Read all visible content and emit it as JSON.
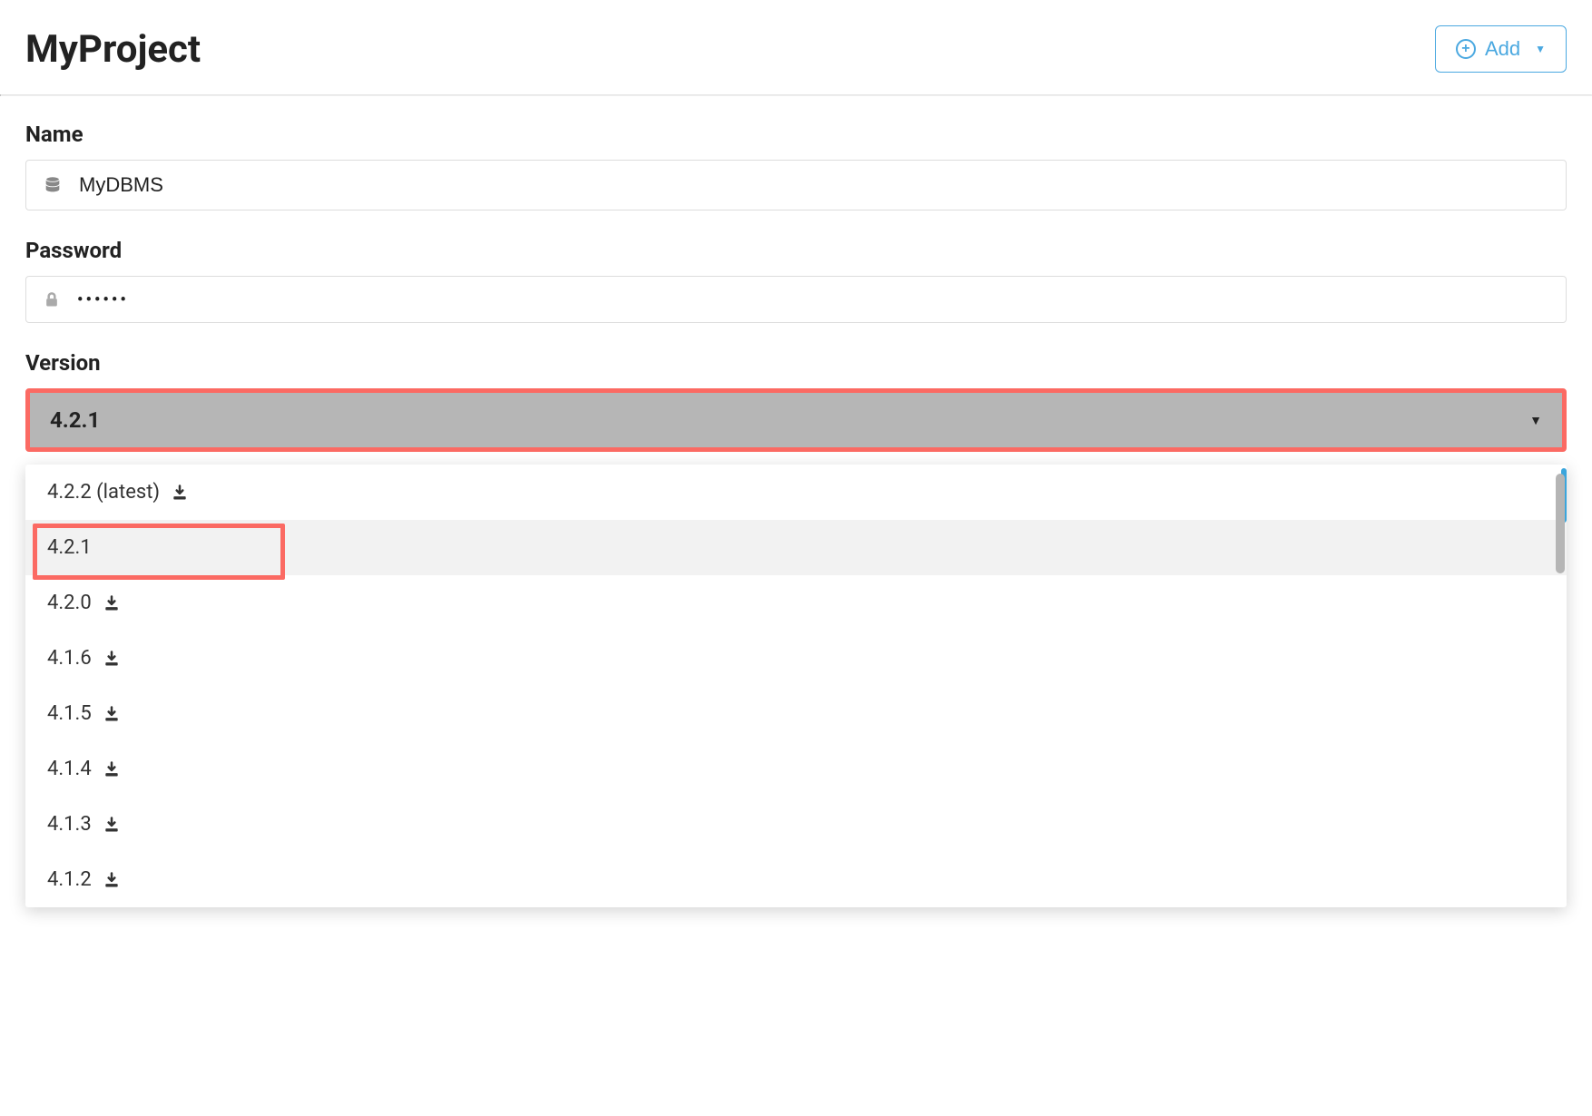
{
  "header": {
    "project_title": "MyProject",
    "add_label": "Add"
  },
  "form": {
    "name": {
      "label": "Name",
      "value": "MyDBMS"
    },
    "password": {
      "label": "Password",
      "value": "••••••"
    },
    "version": {
      "label": "Version",
      "selected": "4.2.1",
      "options": [
        {
          "label": "4.2.2 (latest)",
          "downloadable": true,
          "selected": false
        },
        {
          "label": "4.2.1",
          "downloadable": false,
          "selected": true
        },
        {
          "label": "4.2.0",
          "downloadable": true,
          "selected": false
        },
        {
          "label": "4.1.6",
          "downloadable": true,
          "selected": false
        },
        {
          "label": "4.1.5",
          "downloadable": true,
          "selected": false
        },
        {
          "label": "4.1.4",
          "downloadable": true,
          "selected": false
        },
        {
          "label": "4.1.3",
          "downloadable": true,
          "selected": false
        },
        {
          "label": "4.1.2",
          "downloadable": true,
          "selected": false
        }
      ]
    }
  },
  "colors": {
    "highlight": "#fb6a63",
    "accent": "#4aa8e0"
  }
}
